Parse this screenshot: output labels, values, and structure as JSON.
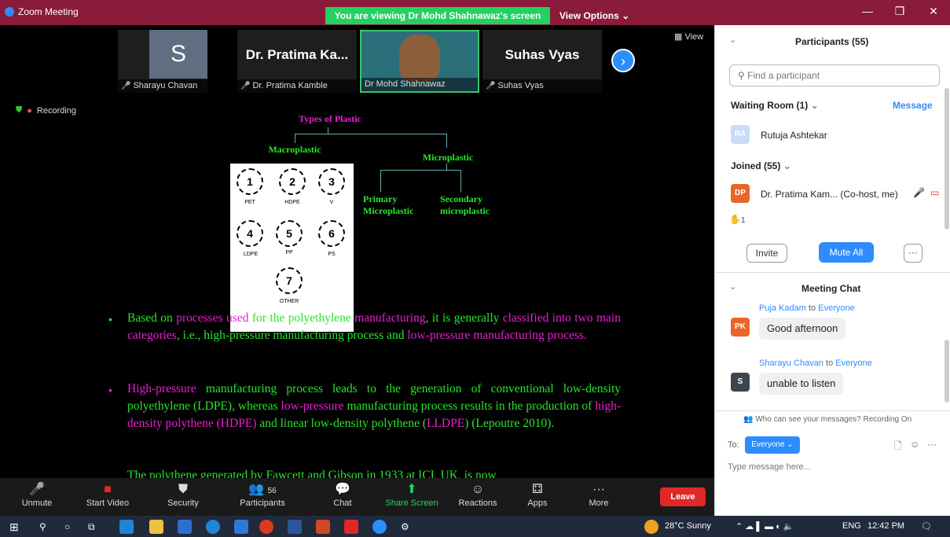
{
  "titlebar": {
    "app_name": "Zoom Meeting",
    "viewing_banner": "You are viewing Dr Mohd Shahnawaz's screen",
    "view_options": "View Options ⌄"
  },
  "thumbnails": [
    {
      "initial": "S",
      "name": "Sharayu Chavan"
    },
    {
      "big_name": "Dr. Pratima Ka...",
      "name": "Dr. Pratima Kamble"
    },
    {
      "name": "Dr Mohd Shahnawaz"
    },
    {
      "big_name": "Suhas Vyas",
      "name": "Suhas Vyas"
    }
  ],
  "view_label": "View",
  "recording_label": "Recording",
  "slide": {
    "title": "Types of Plastic",
    "macro": "Macroplastic",
    "micro": "Microplastic",
    "primary": "Primary Microplastic",
    "secondary": "Secondary microplastic",
    "symbols": [
      {
        "n": "1",
        "label": "PET"
      },
      {
        "n": "2",
        "label": "HDPE"
      },
      {
        "n": "3",
        "label": "V"
      },
      {
        "n": "4",
        "label": "LDPE"
      },
      {
        "n": "5",
        "label": "PP"
      },
      {
        "n": "6",
        "label": "PS"
      },
      {
        "n": "7",
        "label": "OTHER"
      }
    ],
    "p1_a": "Based on ",
    "p1_b": "processes used",
    "p1_c": " for the polyethylene ",
    "p1_d": "manufacturing",
    "p1_e": ", it is generally ",
    "p1_f": "classified into two main categories",
    "p1_g": ", i.e., high-pressure manufacturing process and ",
    "p1_h": "low-pressure manufacturing process.",
    "p2_a": "High-pressure",
    "p2_b": " manufacturing process leads to the generation of conventional low-density polyethylene (LDPE), whereas ",
    "p2_c": "low-pressure",
    "p2_d": " manufacturing process results in the production of ",
    "p2_e": "high-density polythene (HDPE)",
    "p2_f": " and linear low-density polythene (",
    "p2_g": "LLDPE",
    "p2_h": ") (Lepoutre 2010).",
    "p3": "The polythene generated by Fawcett and Gibson in 1933 at ICI, UK, is now"
  },
  "toolbar": {
    "unmute": "Unmute",
    "start_video": "Start Video",
    "security": "Security",
    "participants": "Participants",
    "participant_count": "56",
    "chat": "Chat",
    "share_screen": "Share Screen",
    "reactions": "Reactions",
    "apps": "Apps",
    "more": "More",
    "leave": "Leave"
  },
  "panel": {
    "title": "Participants (55)",
    "search_placeholder": "Find a participant",
    "waiting_room": "Waiting Room (1)",
    "message": "Message",
    "waiting_person_initials": "RA",
    "waiting_person": "Rutuja Ashtekar",
    "joined": "Joined (55)",
    "host_initials": "DP",
    "host_name": "Dr. Pratima Kam...",
    "host_role": "(Co-host, me)",
    "raised_count": "1",
    "invite": "Invite",
    "mute_all": "Mute All",
    "chat_title": "Meeting Chat",
    "messages": [
      {
        "initials": "PK",
        "from": "Puja Kadam",
        "to": "to",
        "to_who": "Everyone",
        "text": "Good afternoon"
      },
      {
        "initials": "S",
        "from": "Sharayu Chavan",
        "to": "to",
        "to_who": "Everyone",
        "text": "unable to listen"
      }
    ],
    "privacy_note": "Who can see your messages? Recording On",
    "to_label": "To:",
    "to_value": "Everyone ⌄",
    "input_placeholder": "Type message here..."
  },
  "taskbar": {
    "weather": "28°C  Sunny",
    "lang": "ENG",
    "time": "12:42 PM"
  },
  "colors": {
    "title": "#8a1b3a",
    "accent": "#2d8cff",
    "green": "#26e62b",
    "magenta": "#e81fcf",
    "leave": "#e02828"
  }
}
